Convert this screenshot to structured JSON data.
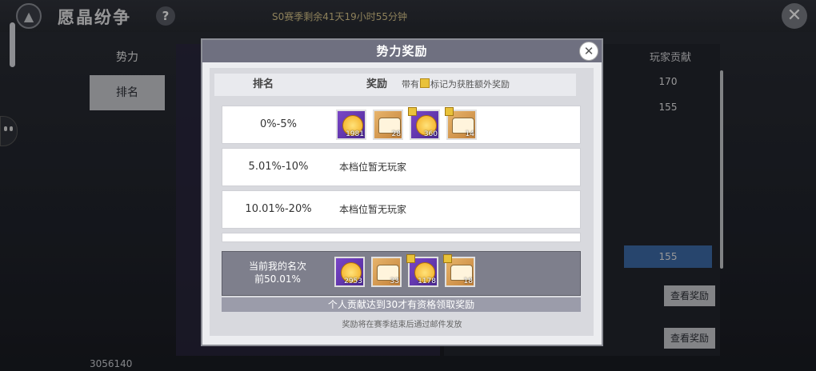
{
  "header": {
    "title": "愿晶纷争",
    "help_label": "?",
    "season_timer": "S0赛季剩余41天19小时55分钟",
    "close_label": "✕"
  },
  "nav": {
    "items": [
      {
        "label": "势力"
      },
      {
        "label": "排名"
      }
    ],
    "active_index": 1
  },
  "user_id": "3056140",
  "background_table": {
    "column_header": "玩家贡献",
    "values": [
      "170",
      "155",
      "155"
    ],
    "button_label": "查看奖励"
  },
  "modal": {
    "title": "势力奖励",
    "close_label": "✕",
    "columns": {
      "rank": "排名",
      "reward": "奖励"
    },
    "note_before": "带有",
    "note_after": "标记为获胜额外奖励",
    "tiers": [
      {
        "range": "0%-5%",
        "rewards": [
          {
            "type": "coin",
            "count": "1981",
            "bonus": false
          },
          {
            "type": "chest",
            "count": "28",
            "bonus": false
          },
          {
            "type": "coin",
            "count": "360",
            "bonus": true
          },
          {
            "type": "chest",
            "count": "14",
            "bonus": true
          }
        ]
      },
      {
        "range": "5.01%-10%",
        "empty_text": "本档位暂无玩家"
      },
      {
        "range": "10.01%-20%",
        "empty_text": "本档位暂无玩家"
      }
    ],
    "current": {
      "line1": "当前我的名次",
      "line2": "前50.01%",
      "rewards": [
        {
          "type": "coin",
          "count": "2953",
          "bonus": false
        },
        {
          "type": "chest",
          "count": "33",
          "bonus": false
        },
        {
          "type": "coin",
          "count": "1178",
          "bonus": true
        },
        {
          "type": "chest",
          "count": "18",
          "bonus": true
        }
      ]
    },
    "requirement": "个人贡献达到30才有资格领取奖励",
    "footer": "奖励将在赛季结束后通过邮件发放"
  },
  "colors": {
    "accent": "#6f7080",
    "bonus_badge": "#e9c23a",
    "coin_bg": "#7a46c7",
    "chest_bg": "#e7b46b"
  }
}
